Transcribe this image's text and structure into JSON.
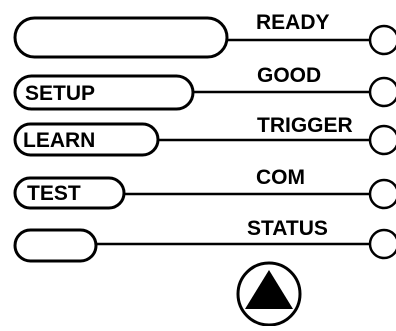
{
  "rows": [
    {
      "button_label": "",
      "status_label": "READY"
    },
    {
      "button_label": "SETUP",
      "status_label": "GOOD"
    },
    {
      "button_label": "LEARN",
      "status_label": "TRIGGER"
    },
    {
      "button_label": "TEST",
      "status_label": "COM"
    },
    {
      "button_label": "",
      "status_label": "STATUS"
    }
  ],
  "action_button": {
    "icon": "triangle-up-icon"
  },
  "colors": {
    "stroke": "#000000",
    "background": "#ffffff"
  }
}
